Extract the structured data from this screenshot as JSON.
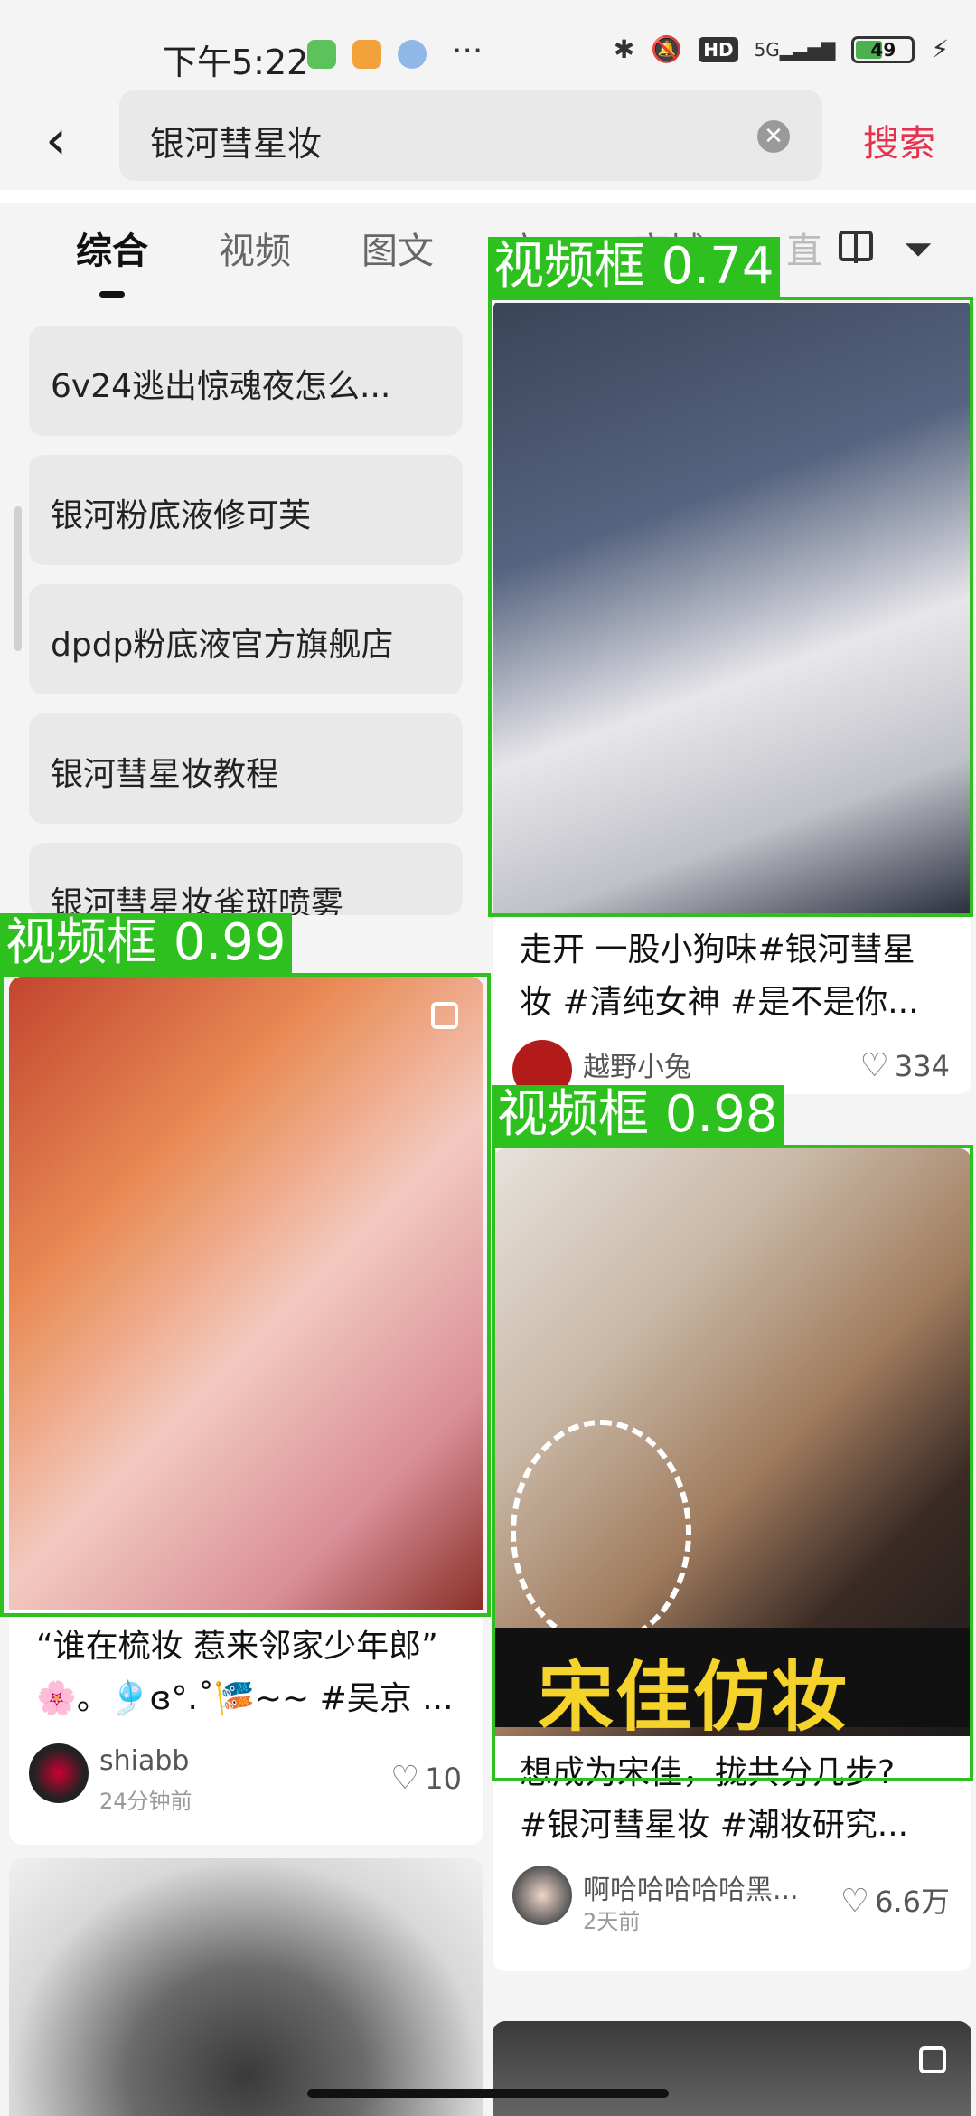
{
  "status_bar": {
    "time": "下午5:22",
    "more": "···",
    "hd": "HD",
    "network": "5G",
    "battery": "49"
  },
  "search": {
    "back_icon": "back-arrow-icon",
    "query": "银河彗星妆",
    "clear_icon": "clear-icon",
    "button_label": "搜索"
  },
  "tabs": {
    "items": [
      "综合",
      "视频",
      "图文",
      "户",
      "商城",
      "直"
    ],
    "active": "综合"
  },
  "suggestions": [
    "6v24逃出惊魂夜怎么...",
    "银河粉底液修可芙",
    "dpdp粉底液官方旗舰店",
    "银河彗星妆教程",
    "银河彗星妆雀斑喷雾"
  ],
  "cards": {
    "left1": {
      "title_line1": "“谁在梳妆 惹来邻家少年郎”",
      "title_line2": "🌸。🎐ɞ°.˚🎏~~ #吴京 ...",
      "author": "shiabb",
      "time": "24分钟前",
      "likes": "10"
    },
    "right1": {
      "title_line1": "走开 一股小狗味#银河彗星",
      "title_line2": "妆 #清纯女神 #是不是你...",
      "author": "越野小兔",
      "likes": "334"
    },
    "right2": {
      "overlay_text": "宋佳仿妆",
      "title_line1": "想成为宋佳，拢共分几步?",
      "title_line2": "#银河彗星妆 #潮妆研究...",
      "author": "啊哈哈哈哈哈黑...",
      "time": "2天前",
      "likes": "6.6万"
    }
  },
  "detections": [
    {
      "label": "视频框 0.74"
    },
    {
      "label": "视频框 0.99"
    },
    {
      "label": "视频框 0.98"
    }
  ],
  "colors": {
    "accent": "#e4334d",
    "detection": "#2ec01e"
  }
}
